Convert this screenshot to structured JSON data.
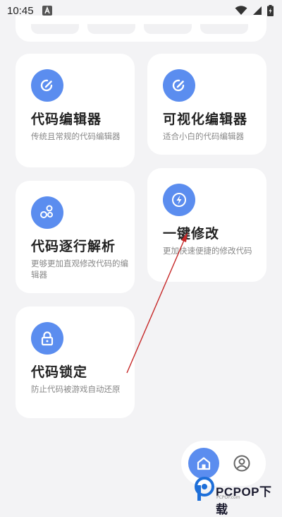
{
  "status": {
    "time": "10:45"
  },
  "cards": [
    {
      "title": "代码编辑器",
      "desc": "传统且常规的代码编辑器",
      "icon": "edit-icon"
    },
    {
      "title": "可视化编辑器",
      "desc": "适合小白的代码编辑器",
      "icon": "edit-icon"
    },
    {
      "title": "代码逐行解析",
      "desc": "更够更加直观修改代码的编辑器",
      "icon": "bubbles-icon"
    },
    {
      "title": "一键修改",
      "desc": "更加快速便捷的修改代码",
      "icon": "lightning-icon"
    },
    {
      "title": "代码锁定",
      "desc": "防止代码被游戏自动还原",
      "icon": "lock-icon"
    }
  ],
  "nav": {
    "home": "home-icon",
    "profile": "profile-icon"
  },
  "watermark": {
    "text": "PCPOP下载",
    "sub": "PCPOP.com"
  },
  "colors": {
    "accent": "#5b8def",
    "background": "#f3f3f5",
    "annotation": "#c62828"
  }
}
